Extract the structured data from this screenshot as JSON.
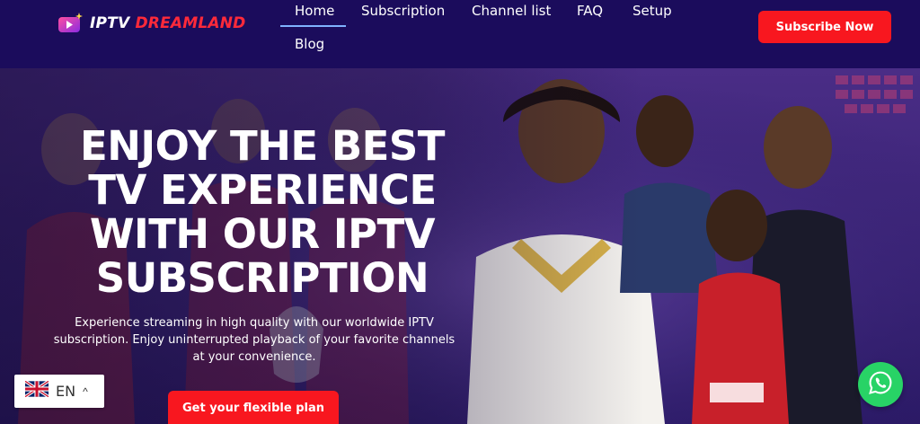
{
  "header": {
    "logo_text_part1": "IPTV",
    "logo_text_part2": "DREAMLAND",
    "nav": {
      "home": "Home",
      "subscription": "Subscription",
      "channel_list": "Channel list",
      "faq": "FAQ",
      "setup": "Setup",
      "blog": "Blog"
    },
    "subscribe_label": "Subscribe Now"
  },
  "hero": {
    "headline_lines": [
      "ENJOY THE BEST",
      "TV EXPERIENCE",
      "WITH OUR IPTV",
      "SUBSCRIPTION"
    ],
    "description": "Experience streaming in high quality with our worldwide IPTV subscription. Enjoy uninterrupted playback of your favorite channels at your convenience.",
    "cta_label": "Get your flexible plan"
  },
  "language_selector": {
    "code": "EN",
    "flag_icon": "uk-flag-icon",
    "caret": "^"
  },
  "whatsapp_icon": "whatsapp-icon",
  "colors": {
    "header_bg": "#1b0c5c",
    "accent_red": "#f8171f",
    "logo_red": "#ff2a3a",
    "nav_underline": "#7fb3ff",
    "whatsapp_green": "#28d366"
  }
}
